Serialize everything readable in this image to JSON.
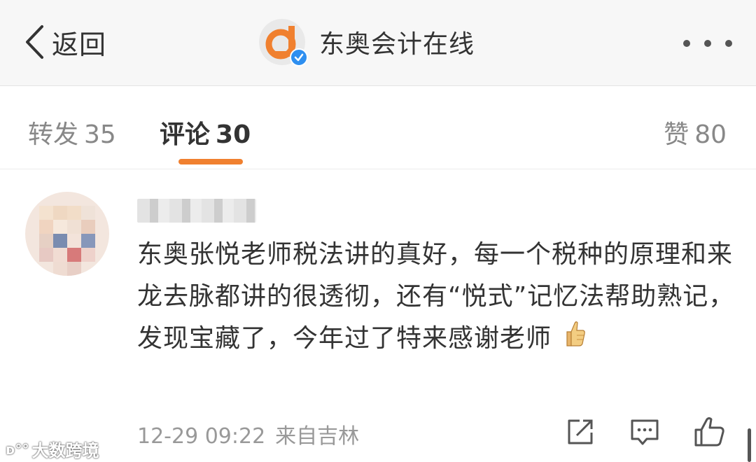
{
  "nav": {
    "back_label": "返回",
    "account_name": "东奥会计在线",
    "brand_color": "#f0802f",
    "verified_color": "#2e8ff0"
  },
  "tabs": [
    {
      "label": "转发",
      "count": "35",
      "active": false
    },
    {
      "label": "评论",
      "count": "30",
      "active": true
    },
    {
      "label": "赞",
      "count": "80",
      "active": false
    }
  ],
  "comment": {
    "text": "东奥张悦老师税法讲的真好，每一个税种的原理和来龙去脉都讲的很透彻，还有“悦式”记忆法帮助熟记，发现宝藏了，今年过了特来感谢老师",
    "emoji": "thumbs-up-emoji",
    "time": "12-29 09:22",
    "source": "来自吉林",
    "actions": [
      "share-icon",
      "reply-icon",
      "like-icon"
    ]
  },
  "watermark": {
    "logo_text": "ᴅ°°",
    "text": "大数跨境"
  }
}
